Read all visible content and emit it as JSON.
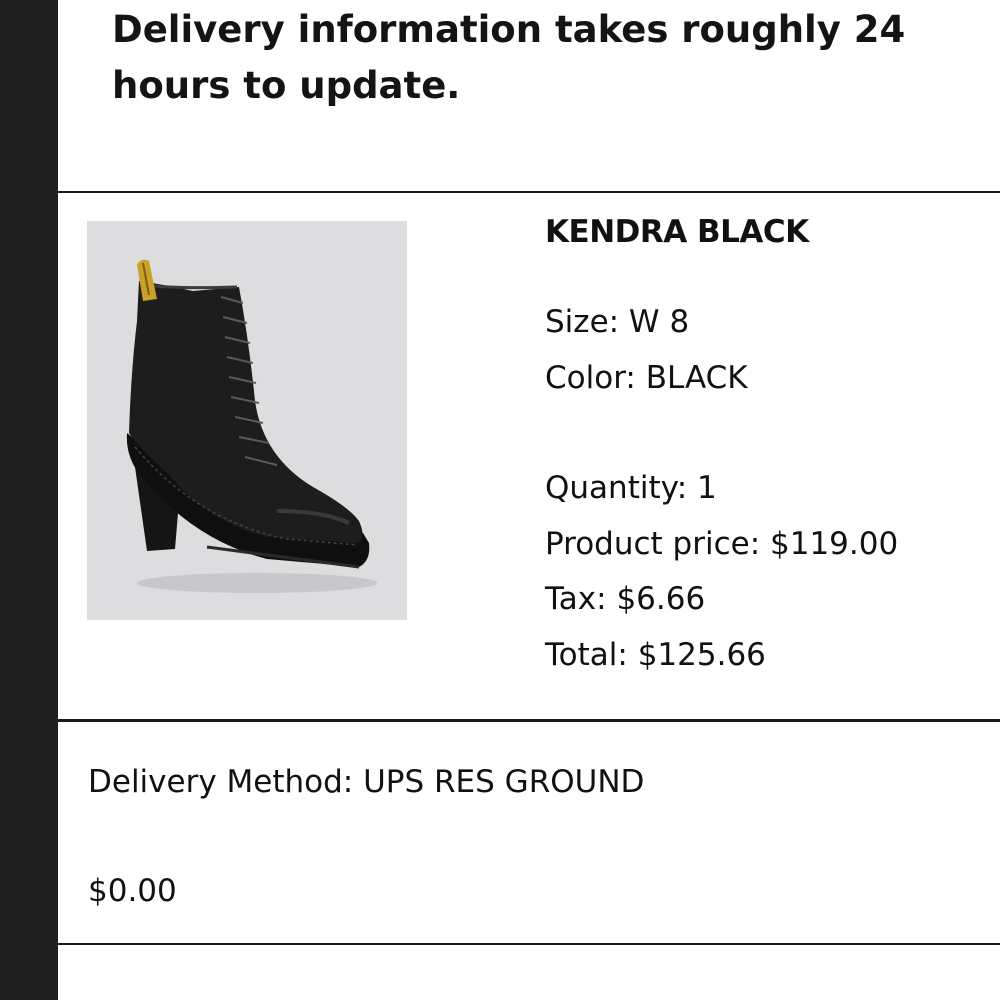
{
  "notice": {
    "text": "Delivery information takes roughly 24 hours to update."
  },
  "product": {
    "name": "KENDRA BLACK",
    "size_label": "Size: W 8",
    "color_label": "Color: BLACK",
    "quantity_label": "Quantity: 1",
    "price_label": "Product price: $119.00",
    "tax_label": "Tax: $6.66",
    "total_label": "Total: $125.66",
    "image_icon": "black-lace-up-heeled-boot"
  },
  "delivery": {
    "method_label": "Delivery Method: UPS RES GROUND",
    "cost": "$0.00"
  },
  "colors": {
    "sidebar": "#1f1f1f",
    "image_background": "#dddddf",
    "boot": "#1b1b1b",
    "heel_tab": "#c9a227"
  }
}
